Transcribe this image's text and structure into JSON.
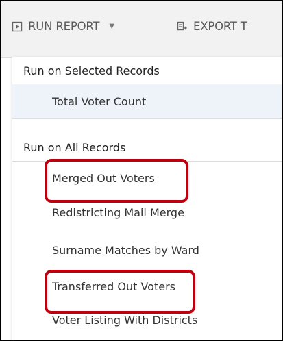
{
  "toolbar": {
    "run_report_label": "RUN REPORT",
    "export_label": "EXPORT T"
  },
  "menu": {
    "sections": [
      {
        "header": "Run on Selected Records",
        "items": [
          {
            "label": "Total Voter Count"
          }
        ]
      },
      {
        "header": "Run on All Records",
        "items": [
          {
            "label": "Merged Out Voters",
            "highlighted": true
          },
          {
            "label": "Redistricting Mail Merge"
          },
          {
            "label": "Surname Matches by Ward"
          },
          {
            "label": "Transferred Out Voters",
            "highlighted": true
          },
          {
            "label": "Voter Listing With Districts"
          }
        ]
      }
    ]
  },
  "icons": {
    "run_report": "report-play-icon",
    "dropdown": "caret-down-icon",
    "export": "export-icon"
  },
  "colors": {
    "highlight_box": "#c0000f",
    "toolbar_bg": "#f2f2f2",
    "selected_section_bg": "#eef3f9",
    "text": "#333333"
  }
}
